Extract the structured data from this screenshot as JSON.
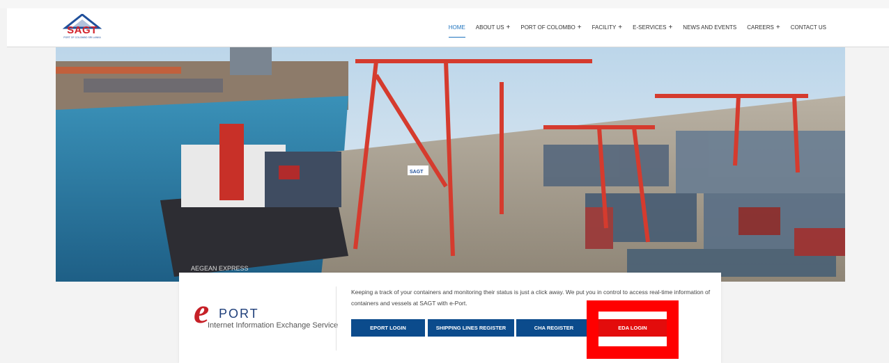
{
  "header": {
    "logo": {
      "text": "SAGT",
      "subtext": "PORT OF COLOMBO SRI LANKA"
    },
    "nav": [
      {
        "label": "HOME",
        "plus": false,
        "active": true
      },
      {
        "label": "ABOUT US",
        "plus": true,
        "active": false
      },
      {
        "label": "PORT OF COLOMBO",
        "plus": true,
        "active": false
      },
      {
        "label": "FACILITY",
        "plus": true,
        "active": false
      },
      {
        "label": "E-SERVICES",
        "plus": true,
        "active": false
      },
      {
        "label": "NEWS AND EVENTS",
        "plus": false,
        "active": false
      },
      {
        "label": "CAREERS",
        "plus": true,
        "active": false
      },
      {
        "label": "CONTACT US",
        "plus": false,
        "active": false
      }
    ]
  },
  "hero": {
    "ship_name": "AEGEAN EXPRESS",
    "crane_label": "SAGT"
  },
  "eport": {
    "logo_e": "e",
    "logo_port": "PORT",
    "logo_sub": "Internet Information Exchange Service",
    "description": "Keeping a track of your containers and monitoring their status is just a click away. We put you in control to access real-time information of containers and vessels at SAGT with e-Port.",
    "buttons": {
      "eport_login": "EPORT LOGIN",
      "shipping_lines_register": "SHIPPING LINES REGISTER",
      "cha_register": "CHA REGISTER",
      "eda_login": "EDA LOGIN"
    }
  },
  "colors": {
    "brand_blue": "#0b4b8c",
    "accent_red": "#e30c0c",
    "nav_active": "#1e73be"
  }
}
